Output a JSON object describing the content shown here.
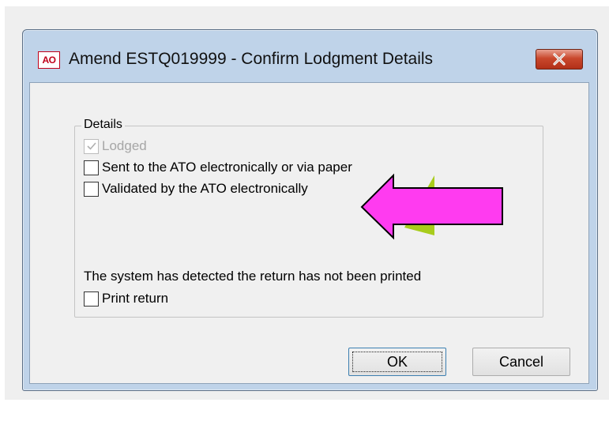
{
  "window": {
    "app_icon_text": "AO",
    "title": "Amend ESTQ019999 - Confirm Lodgment Details"
  },
  "details_group": {
    "legend": "Details",
    "checkboxes": [
      {
        "label": "Lodged",
        "checked": true,
        "enabled": false
      },
      {
        "label": "Sent to the ATO electronically or via paper",
        "checked": false,
        "enabled": true
      },
      {
        "label": "Validated by the ATO electronically",
        "checked": false,
        "enabled": true
      }
    ],
    "notice": "The system has detected the return has not been printed",
    "print_checkbox": {
      "label": "Print return",
      "checked": false,
      "enabled": true
    }
  },
  "buttons": {
    "ok": "OK",
    "cancel": "Cancel"
  },
  "colors": {
    "annotation_arrow_fill": "#ff3bf0",
    "annotation_arrow_shadow": "#a8cc1c",
    "close_button": "#c9482d",
    "app_icon": "#c0001a"
  }
}
